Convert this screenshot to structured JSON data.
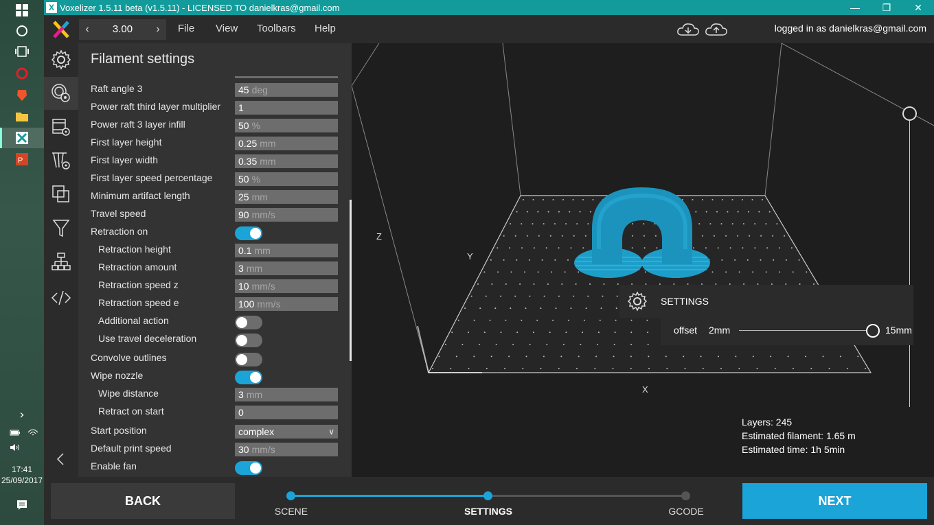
{
  "window": {
    "title": "Voxelizer 1.5.11 beta (v1.5.11) - LICENSED TO danielkras@gmail.com",
    "logo": "X",
    "minimize": "—",
    "maximize": "❐",
    "close": "✕"
  },
  "taskbar": {
    "time": "17:41",
    "date": "25/09/2017",
    "expand": "›"
  },
  "menubar": {
    "version_value": "3.00",
    "prev": "‹",
    "next": "›",
    "items": [
      "File",
      "View",
      "Toolbars",
      "Help"
    ],
    "login": "logged in as danielkras@gmail.com"
  },
  "panel": {
    "title": "Filament settings",
    "rows": [
      {
        "label": "Raft angle 3",
        "type": "field",
        "value": "45",
        "unit": "deg"
      },
      {
        "label": "Power raft third layer multiplier",
        "type": "field",
        "value": "1",
        "unit": ""
      },
      {
        "label": "Power raft 3 layer infill",
        "type": "field",
        "value": "50",
        "unit": "%"
      },
      {
        "label": "First layer height",
        "type": "field",
        "value": "0.25",
        "unit": "mm"
      },
      {
        "label": "First layer width",
        "type": "field",
        "value": "0.35",
        "unit": "mm"
      },
      {
        "label": "First layer speed percentage",
        "type": "field",
        "value": "50",
        "unit": "%"
      },
      {
        "label": "Minimum artifact length",
        "type": "field",
        "value": "25",
        "unit": "mm"
      },
      {
        "label": "Travel speed",
        "type": "field",
        "value": "90",
        "unit": "mm/s"
      },
      {
        "label": "Retraction on",
        "type": "toggle",
        "on": true
      },
      {
        "label": "Retraction height",
        "type": "field",
        "value": "0.1",
        "unit": "mm"
      },
      {
        "label": "Retraction amount",
        "type": "field",
        "value": "3",
        "unit": "mm"
      },
      {
        "label": "Retraction speed z",
        "type": "field",
        "value": "10",
        "unit": "mm/s"
      },
      {
        "label": "Retraction speed e",
        "type": "field",
        "value": "100",
        "unit": "mm/s"
      },
      {
        "label": "Additional action",
        "type": "toggle",
        "on": false
      },
      {
        "label": "Use travel deceleration",
        "type": "toggle",
        "on": false
      },
      {
        "label": "Convolve outlines",
        "type": "toggle",
        "on": false
      },
      {
        "label": "Wipe nozzle",
        "type": "toggle",
        "on": true
      },
      {
        "label": "Wipe distance",
        "type": "field",
        "value": "3",
        "unit": "mm"
      },
      {
        "label": "Retract on start",
        "type": "field",
        "value": "0",
        "unit": ""
      },
      {
        "label": "Start position",
        "type": "select",
        "value": "complex"
      },
      {
        "label": "Default print speed",
        "type": "field",
        "value": "30",
        "unit": "mm/s"
      },
      {
        "label": "Enable fan",
        "type": "toggle",
        "on": true
      }
    ]
  },
  "viewport": {
    "axis_z": "Z",
    "axis_y": "Y",
    "axis_x": "X",
    "popup_title": "SETTINGS",
    "offset_label": "offset",
    "offset_min": "2mm",
    "offset_max": "15mm",
    "offset_value_fraction": 1.0,
    "stats": {
      "layers": "Layers: 245",
      "filament": "Estimated filament: 1.65 m",
      "time": "Estimated time: 1h 5min"
    },
    "model_color": "#1d9ec9"
  },
  "bottombar": {
    "back": "BACK",
    "next": "NEXT",
    "steps": [
      "SCENE",
      "SETTINGS",
      "GCODE"
    ],
    "current_step": 1
  },
  "colors": {
    "accent": "#1aa4d8",
    "titlebar": "#139b9b"
  }
}
